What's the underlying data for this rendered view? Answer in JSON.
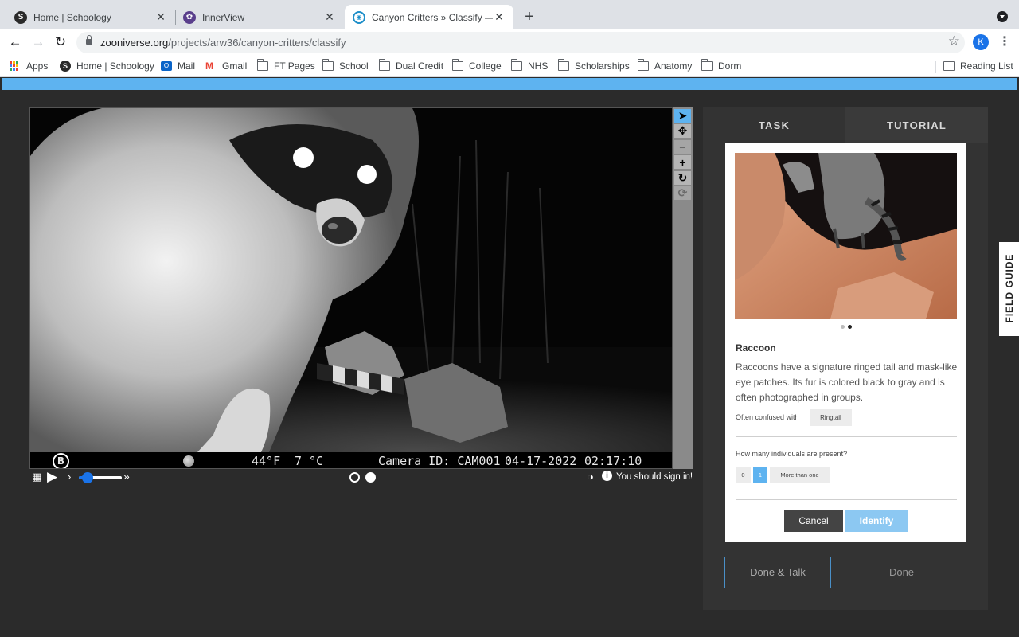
{
  "browser": {
    "tabs": [
      {
        "title": "Home | Schoology",
        "favicon": "schoology-icon",
        "active": false
      },
      {
        "title": "InnerView",
        "favicon": "innerview-icon",
        "active": false
      },
      {
        "title": "Canyon Critters » Classify — Z",
        "favicon": "zooniverse-icon",
        "active": true
      }
    ],
    "url_host": "zooniverse.org",
    "url_path": "/projects/arw36/canyon-critters/classify",
    "profile_initial": "K",
    "bookmarks": [
      {
        "label": "Apps",
        "icon": "apps-grid-icon"
      },
      {
        "label": "Home | Schoology",
        "icon": "schoology-icon"
      },
      {
        "label": "Mail",
        "icon": "outlook-icon"
      },
      {
        "label": "Gmail",
        "icon": "gmail-icon"
      },
      {
        "label": "FT Pages",
        "icon": "folder-icon"
      },
      {
        "label": "School",
        "icon": "folder-icon"
      },
      {
        "label": "Dual Credit",
        "icon": "folder-icon"
      },
      {
        "label": "College",
        "icon": "folder-icon"
      },
      {
        "label": "NHS",
        "icon": "folder-icon"
      },
      {
        "label": "Scholarships",
        "icon": "folder-icon"
      },
      {
        "label": "Anatomy",
        "icon": "folder-icon"
      },
      {
        "label": "Dorm",
        "icon": "folder-icon"
      }
    ],
    "reading_list": "Reading List"
  },
  "viewer": {
    "stamp": {
      "brand": "B",
      "temp_f": "44°F",
      "temp_c": "7 °C",
      "camera": "Camera ID: CAM001",
      "date": "04-17-2022",
      "time": "02:17:10"
    },
    "tools": [
      "pointer-icon",
      "move-icon",
      "minus-icon",
      "plus-icon",
      "rotate-icon",
      "reset-icon"
    ],
    "sign_in_notice": "You should sign in!",
    "frame_count": 2,
    "current_frame": 2
  },
  "panel": {
    "tab_task": "TASK",
    "tab_tutorial": "TUTORIAL",
    "species": "Raccoon",
    "description": "Raccoons have a signature ringed tail and mask-like eye patches. Its fur is colored black to gray and is often photographed in groups.",
    "confused_label": "Often confused with",
    "confused_with": "Ringtail",
    "question": "How many individuals are present?",
    "answers": [
      "0",
      "1",
      "More than one"
    ],
    "selected_answer": "1",
    "cancel": "Cancel",
    "identify": "Identify",
    "done_talk": "Done & Talk",
    "done": "Done",
    "field_guide": "FIELD GUIDE"
  },
  "colors": {
    "accent_blue": "#5eb3f0",
    "panel_bg": "#333333",
    "page_bg": "#2b2b2b"
  }
}
